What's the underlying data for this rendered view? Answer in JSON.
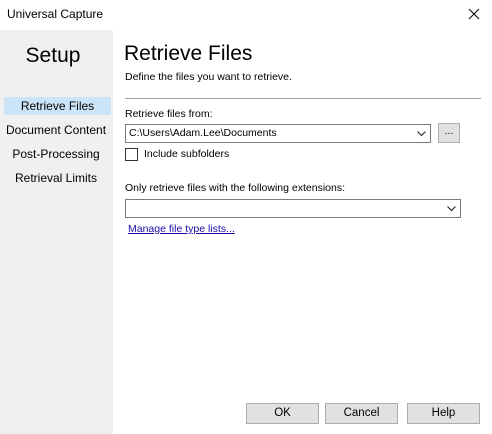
{
  "window": {
    "title": "Universal Capture",
    "close_icon": "close-icon"
  },
  "sidebar": {
    "heading": "Setup",
    "items": [
      {
        "label": "Retrieve Files",
        "active": true
      },
      {
        "label": "Document Content",
        "active": false
      },
      {
        "label": "Post-Processing",
        "active": false
      },
      {
        "label": "Retrieval Limits",
        "active": false
      }
    ],
    "active_color": "#cce4f7"
  },
  "main": {
    "title": "Retrieve Files",
    "subtitle": "Define the files you want to retrieve.",
    "retrieve_from": {
      "label": "Retrieve files from:",
      "value": "C:\\Users\\Adam.Lee\\Documents",
      "browse_label": "..."
    },
    "include_subfolders": {
      "label": "Include subfolders",
      "checked": false
    },
    "extensions": {
      "label": "Only retrieve files with the following extensions:",
      "value": ""
    },
    "manage_link": "Manage file type lists..."
  },
  "buttons": {
    "ok": "OK",
    "cancel": "Cancel",
    "help": "Help"
  },
  "colors": {
    "sidebar_bg": "#f0f0f0",
    "link": "#1a0dab",
    "button_bg": "#e1e1e1"
  }
}
